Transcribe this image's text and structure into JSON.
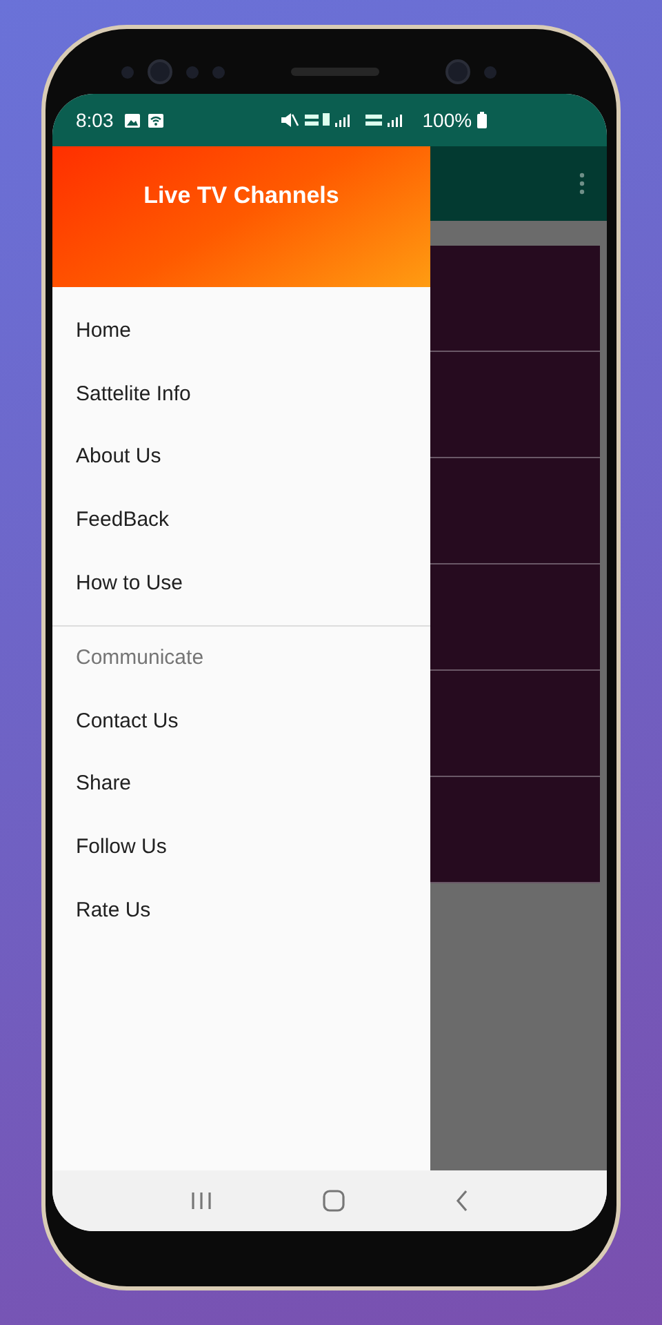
{
  "status_bar": {
    "time": "8:03",
    "battery": "100%"
  },
  "drawer": {
    "title": "Live TV Channels",
    "items": [
      {
        "kind": "item",
        "label": "Home"
      },
      {
        "kind": "item",
        "label": "Sattelite Info"
      },
      {
        "kind": "item",
        "label": "About Us"
      },
      {
        "kind": "item",
        "label": "FeedBack"
      },
      {
        "kind": "item",
        "label": "How to Use"
      },
      {
        "kind": "section",
        "label": "Communicate"
      },
      {
        "kind": "item",
        "label": "Contact Us"
      },
      {
        "kind": "item",
        "label": "Share"
      },
      {
        "kind": "item",
        "label": "Follow Us"
      },
      {
        "kind": "item",
        "label": "Rate Us"
      }
    ]
  },
  "channel_cards": [
    {
      "kind": "card"
    },
    {
      "kind": "card"
    },
    {
      "kind": "card"
    },
    {
      "kind": "card"
    },
    {
      "kind": "card"
    },
    {
      "kind": "card"
    }
  ]
}
